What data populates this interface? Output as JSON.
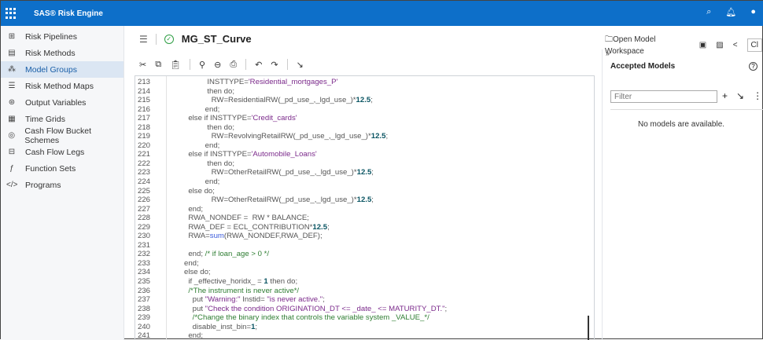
{
  "app": {
    "title": "SAS® Risk Engine",
    "icons": [
      "search-icon",
      "bell-icon",
      "user-icon"
    ]
  },
  "sidebar": {
    "items": [
      {
        "label": "Risk Pipelines",
        "icon": "pipeline-icon",
        "glyph": "⊞"
      },
      {
        "label": "Risk Methods",
        "icon": "document-icon",
        "glyph": "▤"
      },
      {
        "label": "Model Groups",
        "icon": "model-groups-icon",
        "glyph": "⁂",
        "active": true
      },
      {
        "label": "Risk Method Maps",
        "icon": "list-map-icon",
        "glyph": "☰"
      },
      {
        "label": "Output Variables",
        "icon": "output-icon",
        "glyph": "⊛"
      },
      {
        "label": "Time Grids",
        "icon": "calendar-icon",
        "glyph": "▦"
      },
      {
        "label": "Cash Flow Bucket Schemes",
        "icon": "bucket-icon",
        "glyph": "◎"
      },
      {
        "label": "Cash Flow Legs",
        "icon": "legs-icon",
        "glyph": "⊟"
      },
      {
        "label": "Function Sets",
        "icon": "function-icon",
        "glyph": "ƒ"
      },
      {
        "label": "Programs",
        "icon": "code-icon",
        "glyph": "</>"
      }
    ]
  },
  "header": {
    "title": "MG_ST_Curve",
    "status": "valid"
  },
  "toolbar": [
    "cut-icon",
    "copy-icon",
    "paste-icon",
    "find-icon",
    "replace-icon",
    "print-icon",
    "undo-icon",
    "redo-icon",
    "import-icon"
  ],
  "right_toolbar": {
    "open_workspace": "Open Model Workspace",
    "close_label": "Cl"
  },
  "accepted": {
    "title": "Accepted Models",
    "filter_placeholder": "Filter",
    "empty": "No models are available."
  },
  "code": [
    {
      "n": "213",
      "s": [
        [
          "plain",
          "              INSTTYPE="
        ],
        [
          "str",
          "'Residential_mortgages_P'"
        ]
      ]
    },
    {
      "n": "214",
      "s": [
        [
          "plain",
          "              then do;"
        ]
      ]
    },
    {
      "n": "215",
      "s": [
        [
          "plain",
          "                RW=ResidentialRW(_pd_use_,_lgd_use_)*"
        ],
        [
          "num-l",
          "12.5"
        ],
        [
          "plain",
          ";"
        ]
      ]
    },
    {
      "n": "216",
      "s": [
        [
          "plain",
          "             end;"
        ]
      ]
    },
    {
      "n": "217",
      "s": [
        [
          "plain",
          "     else if INSTTYPE="
        ],
        [
          "str",
          "'Credit_cards'"
        ]
      ]
    },
    {
      "n": "218",
      "s": [
        [
          "plain",
          "              then do;"
        ]
      ]
    },
    {
      "n": "219",
      "s": [
        [
          "plain",
          "                RW=RevolvingRetailRW(_pd_use_,_lgd_use_)*"
        ],
        [
          "num-l",
          "12.5"
        ],
        [
          "plain",
          ";"
        ]
      ]
    },
    {
      "n": "220",
      "s": [
        [
          "plain",
          "             end;"
        ]
      ]
    },
    {
      "n": "221",
      "s": [
        [
          "plain",
          "     else if INSTTYPE="
        ],
        [
          "str",
          "'Automobile_Loans'"
        ]
      ]
    },
    {
      "n": "222",
      "s": [
        [
          "plain",
          "              then do;"
        ]
      ]
    },
    {
      "n": "223",
      "s": [
        [
          "plain",
          "                RW=OtherRetailRW(_pd_use_,_lgd_use_)*"
        ],
        [
          "num-l",
          "12.5"
        ],
        [
          "plain",
          ";"
        ]
      ]
    },
    {
      "n": "224",
      "s": [
        [
          "plain",
          "             end;"
        ]
      ]
    },
    {
      "n": "225",
      "s": [
        [
          "plain",
          "     else do;"
        ]
      ]
    },
    {
      "n": "226",
      "s": [
        [
          "plain",
          "                RW=OtherRetailRW(_pd_use_,_lgd_use_)*"
        ],
        [
          "num-l",
          "12.5"
        ],
        [
          "plain",
          ";"
        ]
      ]
    },
    {
      "n": "227",
      "s": [
        [
          "plain",
          "     end;"
        ]
      ]
    },
    {
      "n": "228",
      "s": [
        [
          "plain",
          "     RWA_NONDEF =  RW * BALANCE;"
        ]
      ]
    },
    {
      "n": "229",
      "s": [
        [
          "plain",
          "     RWA_DEF = ECL_CONTRIBUTION*"
        ],
        [
          "num-l",
          "12.5"
        ],
        [
          "plain",
          ";"
        ]
      ]
    },
    {
      "n": "230",
      "s": [
        [
          "plain",
          "     RWA="
        ],
        [
          "fn",
          "sum"
        ],
        [
          "plain",
          "(RWA_NONDEF,RWA_DEF);"
        ]
      ]
    },
    {
      "n": "231",
      "s": [
        [
          "plain",
          ""
        ]
      ]
    },
    {
      "n": "232",
      "s": [
        [
          "plain",
          "     end; "
        ],
        [
          "cmt",
          "/* if loan_age > 0 */"
        ]
      ]
    },
    {
      "n": "233",
      "s": [
        [
          "plain",
          "   end;"
        ]
      ]
    },
    {
      "n": "234",
      "s": [
        [
          "plain",
          "   else do;"
        ]
      ]
    },
    {
      "n": "235",
      "s": [
        [
          "plain",
          "     if _effective_horidx_ = "
        ],
        [
          "num-l",
          "1"
        ],
        [
          "plain",
          " then do;"
        ]
      ]
    },
    {
      "n": "236",
      "s": [
        [
          "cmt",
          "     /*The instrument is never active*/"
        ]
      ]
    },
    {
      "n": "237",
      "s": [
        [
          "plain",
          "       put "
        ],
        [
          "str",
          "\"Warning:\""
        ],
        [
          "plain",
          " Instid= "
        ],
        [
          "str",
          "\"is never active.\""
        ],
        [
          "plain",
          ";"
        ]
      ]
    },
    {
      "n": "238",
      "s": [
        [
          "plain",
          "       put "
        ],
        [
          "str",
          "\"Check the condition ORIGINATION_DT <= _date_ <= MATURITY_DT.\""
        ],
        [
          "plain",
          ";"
        ]
      ]
    },
    {
      "n": "239",
      "s": [
        [
          "cmt",
          "       /*Change the binary index that controls the variable system _VALUE_*/"
        ]
      ]
    },
    {
      "n": "240",
      "s": [
        [
          "plain",
          "       disable_inst_bin="
        ],
        [
          "num-l",
          "1"
        ],
        [
          "plain",
          ";"
        ]
      ]
    },
    {
      "n": "241",
      "s": [
        [
          "plain",
          "     end;"
        ]
      ]
    }
  ]
}
